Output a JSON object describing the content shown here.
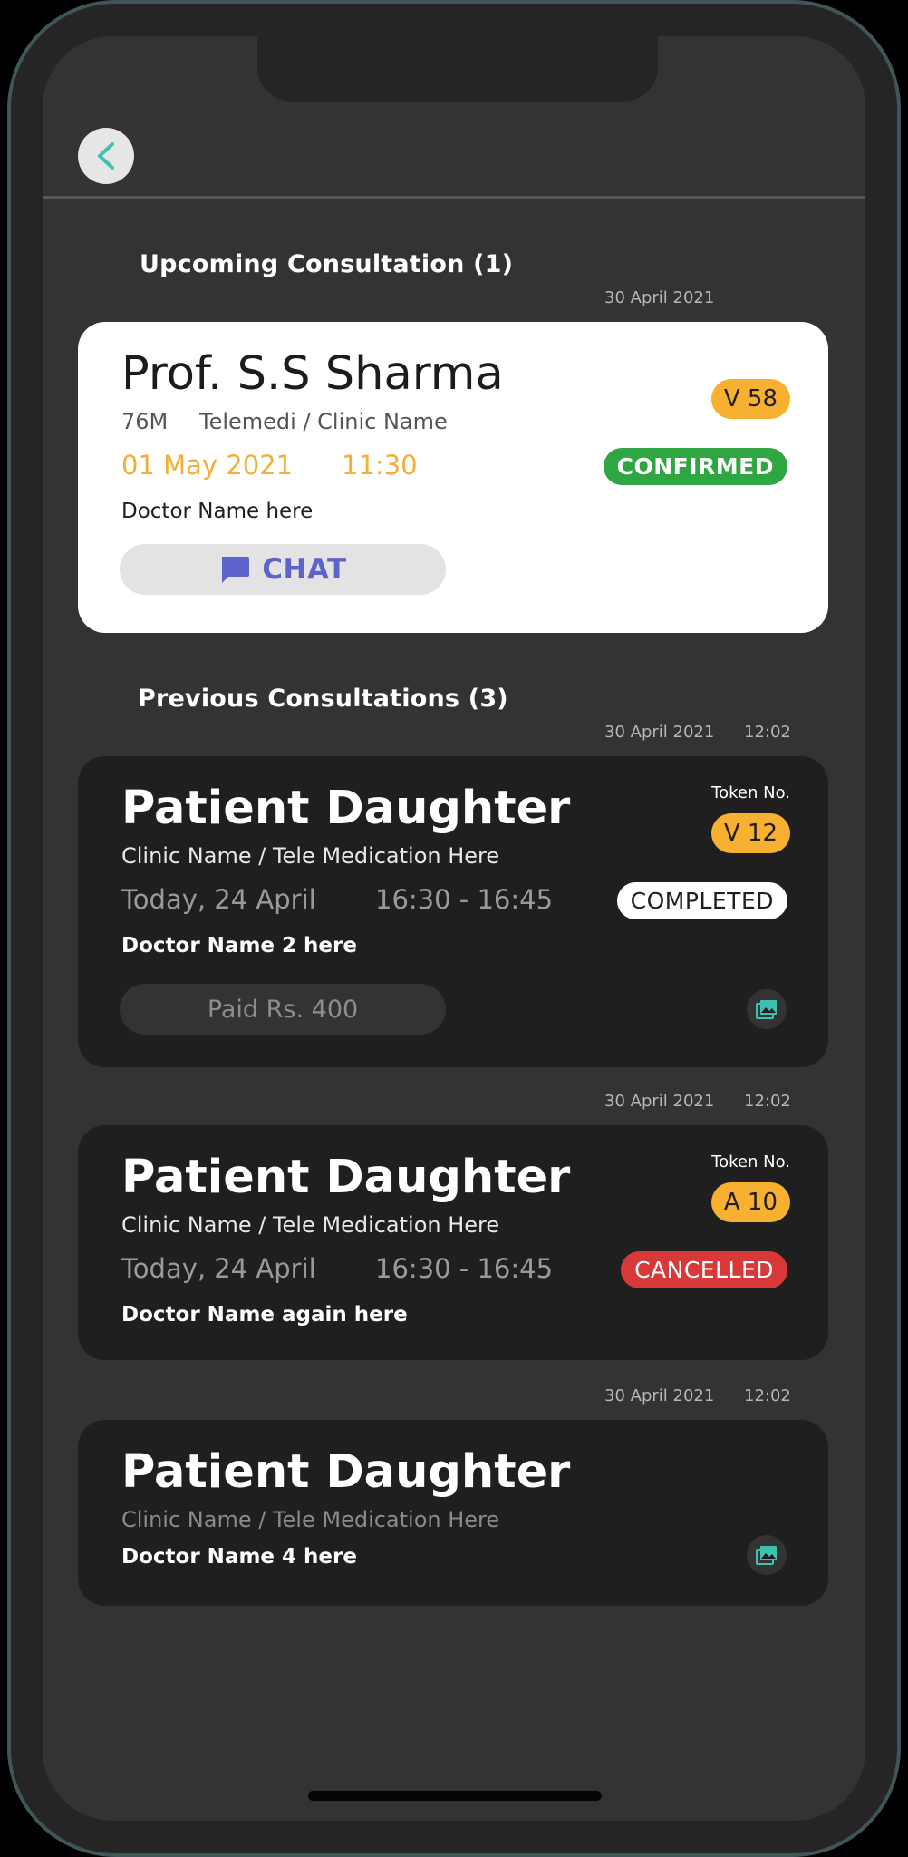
{
  "colors": {
    "frame": "#3f5557",
    "screen": "#333333",
    "accent_teal": "#3fc1b0",
    "token": "#f7b02f",
    "confirmed": "#30a642",
    "cancelled": "#d93838",
    "chat": "#5c64cc"
  },
  "icons": {
    "back": "chevron-left-icon",
    "chat": "chat-bubble-icon",
    "gallery": "image-gallery-icon"
  },
  "upcoming": {
    "title": "Upcoming Consultation (1)",
    "meta_date": "30 April 2021",
    "card": {
      "name": "Prof. S.S Sharma",
      "age_gender": "76M",
      "clinic": "Telemedi / Clinic Name",
      "date": "01 May 2021",
      "time": "11:30",
      "doctor": "Doctor Name here",
      "token": "V 58",
      "status": "CONFIRMED",
      "chat_label": "CHAT"
    }
  },
  "previous": {
    "title": "Previous Consultations (3)",
    "items": [
      {
        "meta_date": "30 April 2021",
        "meta_time": "12:02",
        "name": "Patient Daughter",
        "clinic": "Clinic Name / Tele Medication Here",
        "date": "Today, 24 April",
        "time": "16:30 - 16:45",
        "doctor": "Doctor Name 2 here",
        "token_label": "Token No.",
        "token": "V 12",
        "status": "COMPLETED",
        "paid": "Paid Rs. 400"
      },
      {
        "meta_date": "30 April 2021",
        "meta_time": "12:02",
        "name": "Patient Daughter",
        "clinic": "Clinic Name / Tele Medication Here",
        "date": "Today, 24 April",
        "time": "16:30 - 16:45",
        "doctor": "Doctor Name again here",
        "token_label": "Token No.",
        "token": "A 10",
        "status": "CANCELLED"
      },
      {
        "meta_date": "30 April 2021",
        "meta_time": "12:02",
        "name": "Patient Daughter",
        "clinic": "Clinic Name / Tele Medication Here",
        "doctor": "Doctor Name 4 here"
      }
    ]
  }
}
